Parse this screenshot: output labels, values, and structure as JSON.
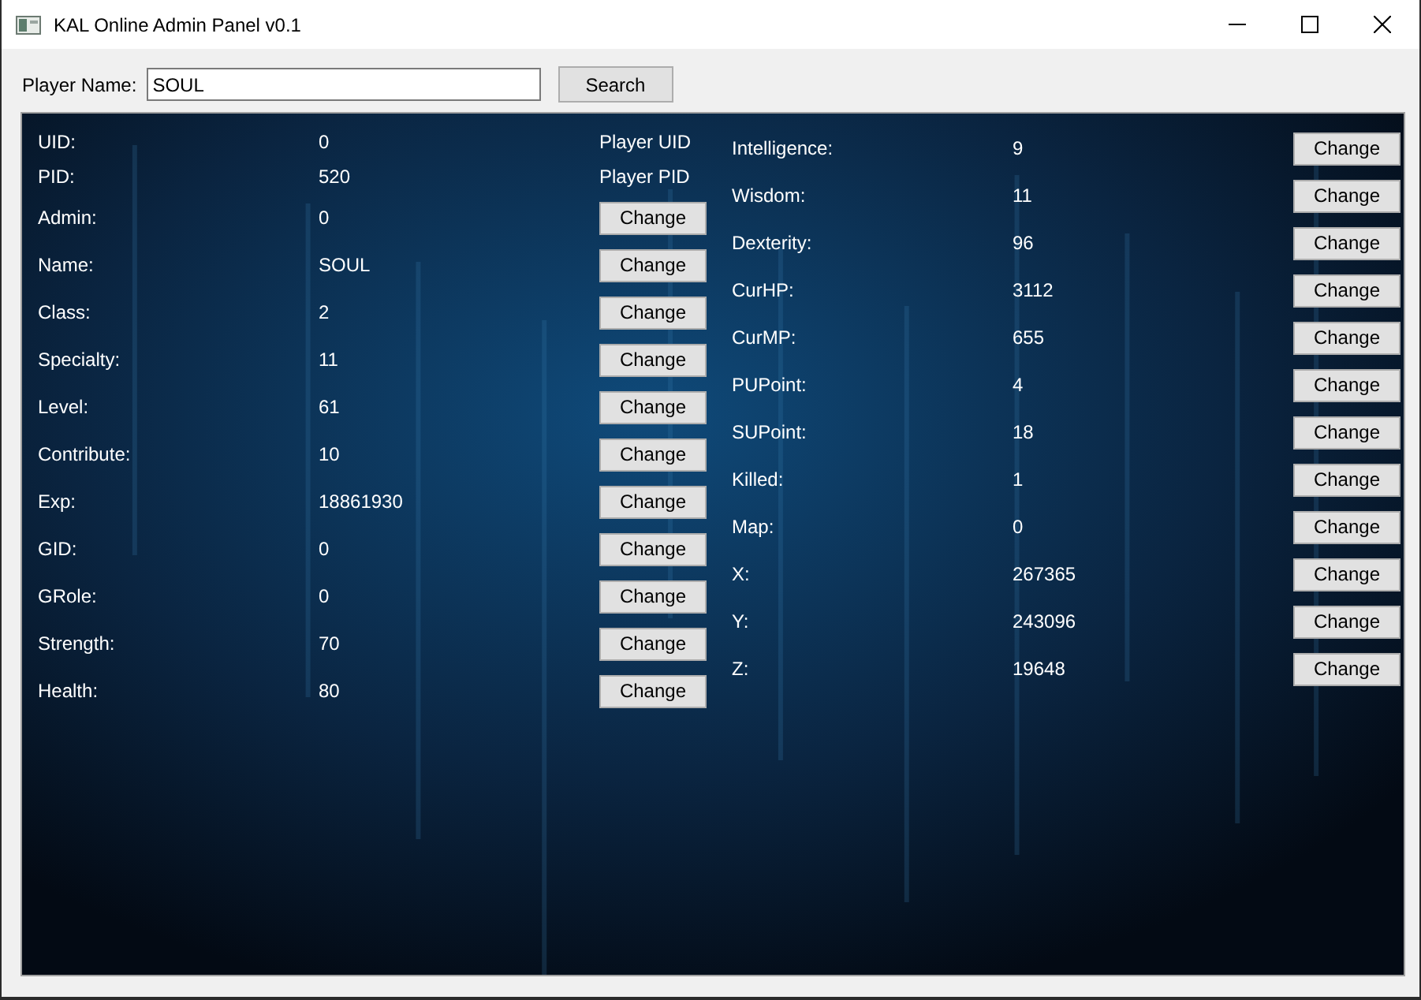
{
  "window": {
    "title": "KAL Online Admin Panel v0.1"
  },
  "search": {
    "label": "Player Name:",
    "value": "SOUL",
    "button": "Search"
  },
  "left_fields": [
    {
      "label": "UID:",
      "value": "0",
      "kind": "note",
      "note": "Player UID"
    },
    {
      "label": "PID:",
      "value": "520",
      "kind": "note",
      "note": "Player PID"
    },
    {
      "label": "Admin:",
      "value": "0",
      "kind": "button",
      "button": "Change"
    },
    {
      "label": "Name:",
      "value": "SOUL",
      "kind": "button",
      "button": "Change"
    },
    {
      "label": "Class:",
      "value": "2",
      "kind": "button",
      "button": "Change"
    },
    {
      "label": "Specialty:",
      "value": "11",
      "kind": "button",
      "button": "Change"
    },
    {
      "label": "Level:",
      "value": "61",
      "kind": "button",
      "button": "Change"
    },
    {
      "label": "Contribute:",
      "value": "10",
      "kind": "button",
      "button": "Change"
    },
    {
      "label": "Exp:",
      "value": "18861930",
      "kind": "button",
      "button": "Change"
    },
    {
      "label": "GID:",
      "value": "0",
      "kind": "button",
      "button": "Change"
    },
    {
      "label": "GRole:",
      "value": "0",
      "kind": "button",
      "button": "Change"
    },
    {
      "label": "Strength:",
      "value": "70",
      "kind": "button",
      "button": "Change"
    },
    {
      "label": "Health:",
      "value": "80",
      "kind": "button",
      "button": "Change"
    }
  ],
  "right_fields": [
    {
      "label": "Intelligence:",
      "value": "9",
      "kind": "button",
      "button": "Change"
    },
    {
      "label": "Wisdom:",
      "value": "11",
      "kind": "button",
      "button": "Change"
    },
    {
      "label": "Dexterity:",
      "value": "96",
      "kind": "button",
      "button": "Change"
    },
    {
      "label": "CurHP:",
      "value": "3112",
      "kind": "button",
      "button": "Change"
    },
    {
      "label": "CurMP:",
      "value": "655",
      "kind": "button",
      "button": "Change"
    },
    {
      "label": "PUPoint:",
      "value": "4",
      "kind": "button",
      "button": "Change"
    },
    {
      "label": "SUPoint:",
      "value": "18",
      "kind": "button",
      "button": "Change"
    },
    {
      "label": "Killed:",
      "value": "1",
      "kind": "button",
      "button": "Change"
    },
    {
      "label": "Map:",
      "value": "0",
      "kind": "button",
      "button": "Change"
    },
    {
      "label": "X:",
      "value": "267365",
      "kind": "button",
      "button": "Change"
    },
    {
      "label": "Y:",
      "value": "243096",
      "kind": "button",
      "button": "Change"
    },
    {
      "label": "Z:",
      "value": "19648",
      "kind": "button",
      "button": "Change"
    }
  ]
}
